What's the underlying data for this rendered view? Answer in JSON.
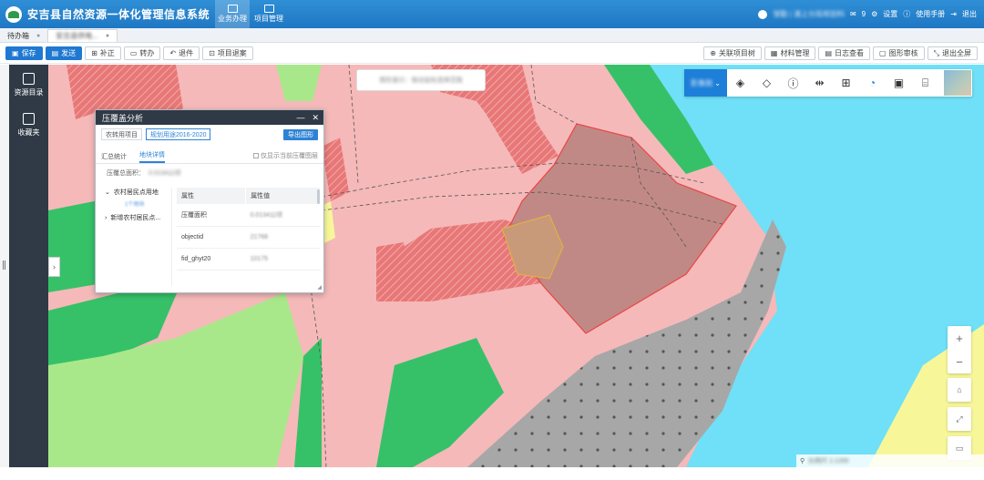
{
  "header": {
    "title": "安吉县自然资源一体化管理信息系统",
    "nav": [
      {
        "label": "业务办理",
        "active": true
      },
      {
        "label": "项目管理",
        "active": false
      }
    ],
    "user": "邹勤 | 浦上分局规划科",
    "messages": "9",
    "settings": "设置",
    "manual": "使用手册",
    "logout": "退出"
  },
  "tabs": [
    {
      "label": "待办箱"
    },
    {
      "label": "安吉县供电..."
    }
  ],
  "toolbar": {
    "left": [
      {
        "label": "保存",
        "primary": true,
        "icon": "save-icon"
      },
      {
        "label": "发送",
        "primary": true,
        "icon": "send-icon"
      },
      {
        "label": "补正",
        "primary": false,
        "icon": "edit-icon"
      },
      {
        "label": "转办",
        "primary": false,
        "icon": "transfer-icon"
      },
      {
        "label": "退件",
        "primary": false,
        "icon": "return-icon"
      },
      {
        "label": "项目退案",
        "primary": false,
        "icon": "withdraw-icon"
      }
    ],
    "right": [
      {
        "label": "关联项目树",
        "icon": "tree-icon"
      },
      {
        "label": "材料管理",
        "icon": "folder-icon"
      },
      {
        "label": "日志查看",
        "icon": "log-icon"
      },
      {
        "label": "图形审核",
        "icon": "shape-icon"
      },
      {
        "label": "退出全屏",
        "icon": "exit-fullscreen-icon"
      }
    ]
  },
  "leftnav": [
    {
      "label": "资源目录",
      "icon": "catalog-icon"
    },
    {
      "label": "收藏夹",
      "icon": "favorites-icon"
    }
  ],
  "map": {
    "search_tip": "图形提示：拖动鼠标选择范围",
    "basemap_select": "影像图",
    "tool_icons": [
      "layers-icon",
      "stack-icon",
      "info-icon",
      "compare-icon",
      "add-icon",
      "pie-icon",
      "gallery-icon",
      "toolbox-icon"
    ],
    "zoom_in": "+",
    "zoom_out": "−",
    "status": "比例尺 1:1200",
    "colors": {
      "pink": "#f5b9b9",
      "green": "#36c168",
      "lightgreen": "#a9e88a",
      "yellow": "#f7f79a",
      "water": "#6fe0f7",
      "gray": "#a7a7a7",
      "red": "#e06c6c",
      "selection": "#b7807d"
    }
  },
  "panel": {
    "title": "压覆盖分析",
    "tab_project": "农转用项目",
    "tab_plan": "规划用途2016-2020",
    "export": "导出图形",
    "subtab_summary": "汇总统计",
    "subtab_detail": "地块详情",
    "show_current": "仅显示当前压覆图层",
    "area_label": "压覆总面积：",
    "area_value": "0.0134公顷",
    "tree": [
      {
        "label": "农村居民点用地",
        "expanded": true,
        "count": "1个地块"
      },
      {
        "label": "新增农村居民点...",
        "expanded": false
      }
    ],
    "props_headers": [
      "属性",
      "属性值"
    ],
    "props_rows": [
      {
        "key": "压覆面积",
        "value": "0.0134公顷"
      },
      {
        "key": "objectid",
        "value": "21768"
      },
      {
        "key": "fid_ghyt20",
        "value": "10175"
      }
    ]
  }
}
